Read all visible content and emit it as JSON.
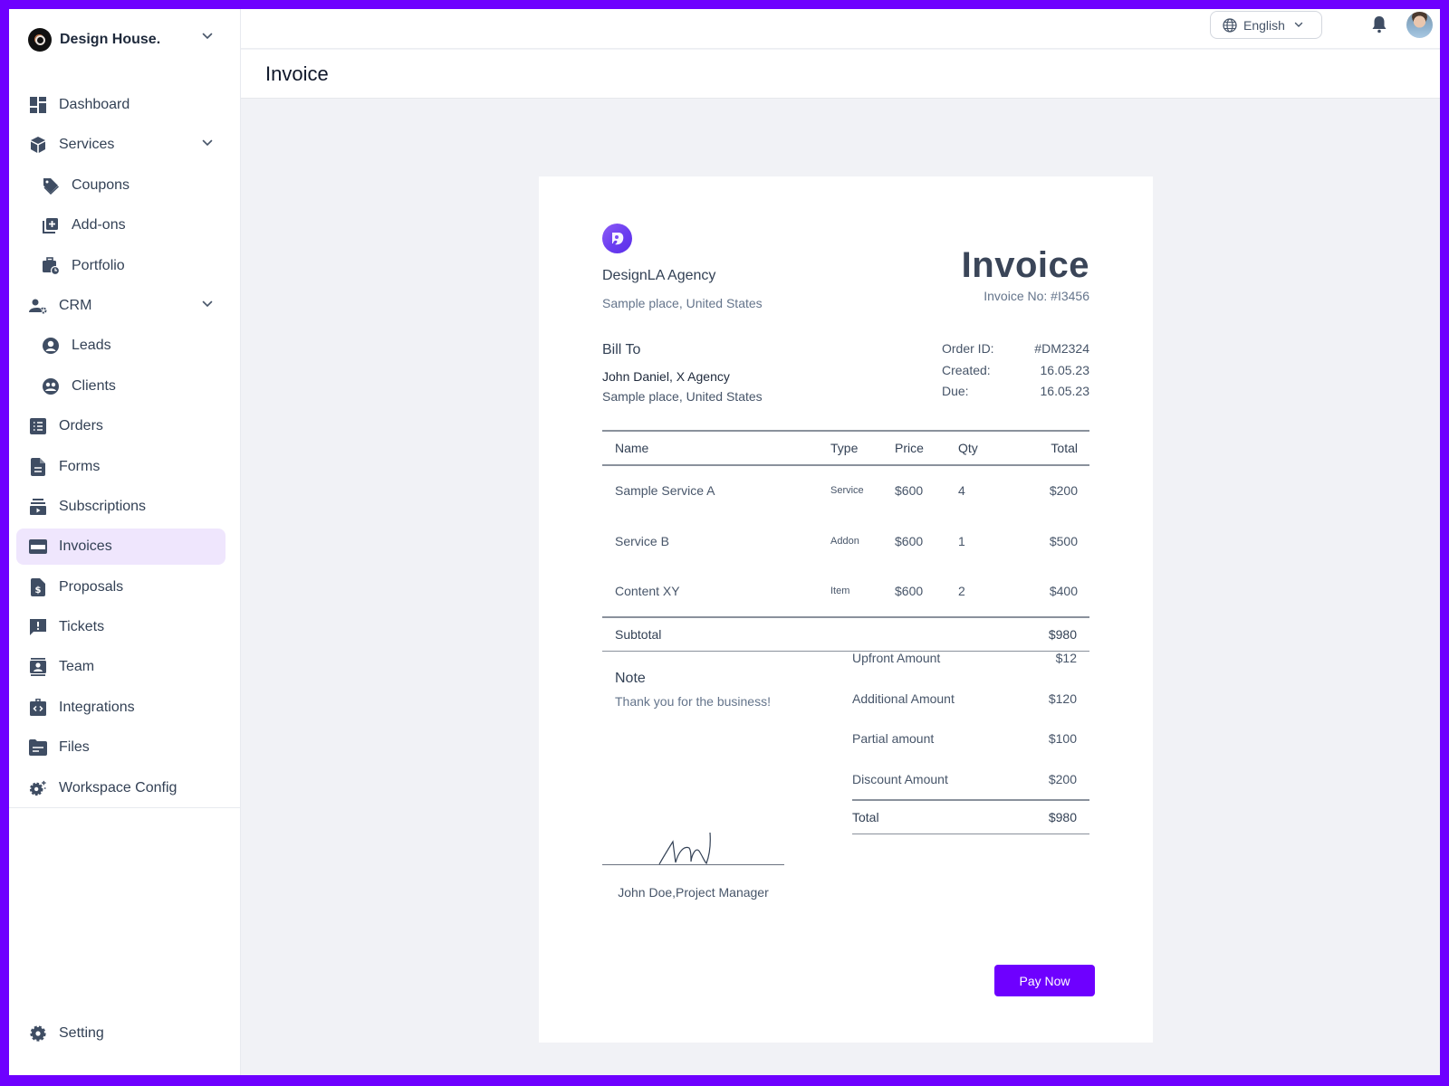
{
  "brand": {
    "name": "Design House.",
    "logo_icon": "brand-logo-icon",
    "dropdown_icon": "chevron-down-icon"
  },
  "sidebar": {
    "items": [
      {
        "label": "Dashboard",
        "icon": "dashboard-icon",
        "level": 0
      },
      {
        "label": "Services",
        "icon": "box-icon",
        "level": 0,
        "expandable": true
      },
      {
        "label": "Coupons",
        "icon": "tag-icon",
        "level": 1
      },
      {
        "label": "Add-ons",
        "icon": "add-box-icon",
        "level": 1
      },
      {
        "label": "Portfolio",
        "icon": "briefcase-clock-icon",
        "level": 1
      },
      {
        "label": "CRM",
        "icon": "user-gear-icon",
        "level": 0,
        "expandable": true
      },
      {
        "label": "Leads",
        "icon": "user-circle-icon",
        "level": 1
      },
      {
        "label": "Clients",
        "icon": "group-icon",
        "level": 1
      },
      {
        "label": "Orders",
        "icon": "list-icon",
        "level": 0
      },
      {
        "label": "Forms",
        "icon": "document-icon",
        "level": 0
      },
      {
        "label": "Subscriptions",
        "icon": "subscriptions-icon",
        "level": 0
      },
      {
        "label": "Invoices",
        "icon": "credit-card-icon",
        "level": 0,
        "active": true
      },
      {
        "label": "Proposals",
        "icon": "dollar-document-icon",
        "level": 0
      },
      {
        "label": "Tickets",
        "icon": "alert-message-icon",
        "level": 0
      },
      {
        "label": "Team",
        "icon": "contact-card-icon",
        "level": 0
      },
      {
        "label": "Integrations",
        "icon": "code-briefcase-icon",
        "level": 0
      },
      {
        "label": "Files",
        "icon": "folder-icon",
        "level": 0
      },
      {
        "label": "Workspace Config",
        "icon": "gear-sparkle-icon",
        "level": 0
      }
    ],
    "footer": {
      "label": "Setting",
      "icon": "gear-icon"
    }
  },
  "topbar": {
    "language": {
      "selected": "English",
      "icon": "globe-icon"
    },
    "notifications_icon": "bell-icon",
    "avatar": "user-avatar"
  },
  "page": {
    "title": "Invoice"
  },
  "invoice": {
    "from": {
      "company": "DesignLA Agency",
      "address": "Sample place, United States"
    },
    "title": "Invoice",
    "number_label": "Invoice No: #I3456",
    "bill_to": {
      "heading": "Bill To",
      "name": "John Daniel, X Agency",
      "address": "Sample place, United States"
    },
    "meta": [
      {
        "label": "Order ID:",
        "value": "#DM2324"
      },
      {
        "label": "Created:",
        "value": "16.05.23"
      },
      {
        "label": "Due:",
        "value": "16.05.23"
      }
    ],
    "columns": {
      "name": "Name",
      "type": "Type",
      "price": "Price",
      "qty": "Qty",
      "total": "Total"
    },
    "rows": [
      {
        "name": "Sample Service A",
        "type": "Service",
        "price": "$600",
        "qty": "4",
        "total": "$200"
      },
      {
        "name": "Service B",
        "type": "Addon",
        "price": "$600",
        "qty": "1",
        "total": "$500"
      },
      {
        "name": "Content XY",
        "type": "Item",
        "price": "$600",
        "qty": "2",
        "total": "$400"
      }
    ],
    "subtotal": {
      "label": "Subtotal",
      "value": "$980"
    },
    "note": {
      "heading": "Note",
      "text": "Thank you for the business!"
    },
    "summary": [
      {
        "label": "Upfront Amount",
        "value": "$12"
      },
      {
        "label": "Additional Amount",
        "value": "$120"
      },
      {
        "label": "Partial amount",
        "value": "$100"
      },
      {
        "label": "Discount Amount",
        "value": "$200"
      }
    ],
    "total": {
      "label": "Total",
      "value": "$980"
    },
    "signer": "John Doe,Project Manager",
    "pay_button": "Pay Now"
  },
  "colors": {
    "accent": "#6e00ff",
    "active_bg": "#efe6fd",
    "text": "#334155",
    "page_bg": "#f1f2f6"
  }
}
